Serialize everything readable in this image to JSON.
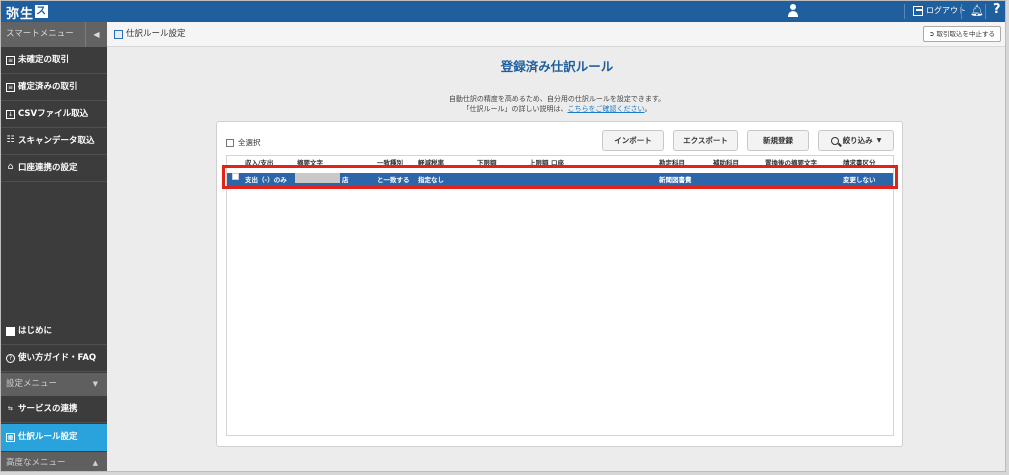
{
  "header": {
    "logo_text": "弥生",
    "logo_mark": "ス",
    "logout_label": "ログアウト",
    "help_label": "?"
  },
  "subheader": {
    "smart_menu_label": "スマートメニュー",
    "collapse_glyph": "◀",
    "page_title": "仕訳ルール設定",
    "stop_button_label": "取引取込を中止する"
  },
  "sidebar": {
    "items": [
      {
        "label": "未確定の取引",
        "icon": "list-icon"
      },
      {
        "label": "確定済みの取引",
        "icon": "check-list-icon"
      },
      {
        "label": "CSVファイル取込",
        "icon": "file-icon"
      },
      {
        "label": "スキャンデータ取込",
        "icon": "scanner-icon"
      },
      {
        "label": "口座連携の設定",
        "icon": "bank-icon"
      }
    ],
    "bottom_items": [
      {
        "label": "はじめに",
        "icon": "book-icon"
      },
      {
        "label": "使い方ガイド・FAQ",
        "icon": "question-icon"
      }
    ],
    "settings_section": "設定メニュー",
    "settings_items": [
      {
        "label": "サービスの連携",
        "icon": "link-icon"
      },
      {
        "label": "仕訳ルール設定",
        "icon": "rule-icon",
        "active": true
      }
    ],
    "advanced_section": "高度なメニュー"
  },
  "main": {
    "title": "登録済み仕訳ルール",
    "desc_line1": "自動仕訳の精度を高めるため、自分用の仕訳ルールを設定できます。",
    "desc_line2_prefix": "「仕訳ルール」の詳しい説明は、",
    "desc_link": "こちらをご確認ください",
    "desc_line2_suffix": "。",
    "select_all_label": "全選択",
    "buttons": {
      "import": "インポート",
      "export": "エクスポート",
      "new": "新規登録",
      "filter": "絞り込み"
    },
    "columns": [
      "収入/支出",
      "摘要文字",
      "一致種別",
      "軽減税率",
      "下限額",
      "上限額",
      "口座",
      "勘定科目",
      "補助科目",
      "置換後の摘要文字",
      "請求書区分"
    ],
    "rows": [
      {
        "type": "支出（-）のみ",
        "keyword_suffix": "店",
        "match": "と一致する",
        "reduced_tax": "指定なし",
        "min": "",
        "max": "",
        "account": "",
        "subject": "新聞図書費",
        "sub_subject": "",
        "replace": "",
        "invoice": "変更しない"
      }
    ]
  },
  "colors": {
    "brand_blue": "#1f5f9e",
    "active_blue": "#2aa3dc",
    "row_selected": "#2c66a9",
    "highlight_red": "#e2231a"
  }
}
